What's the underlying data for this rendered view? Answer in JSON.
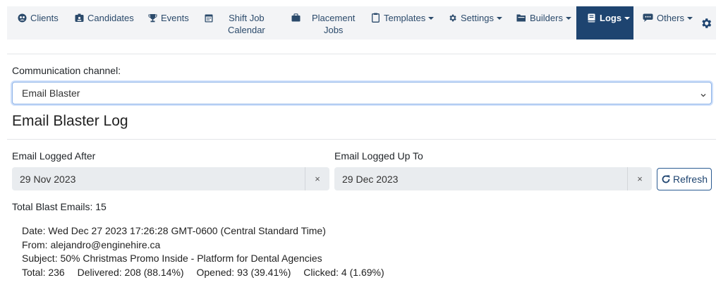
{
  "nav": {
    "clients": "Clients",
    "candidates": "Candidates",
    "events": "Events",
    "shift_line1": "Shift Job",
    "shift_line2": "Calendar",
    "placement_line1": "Placement",
    "placement_line2": "Jobs",
    "templates": "Templates",
    "settings": "Settings",
    "builders": "Builders",
    "logs": "Logs",
    "others": "Others"
  },
  "channel": {
    "label": "Communication channel:",
    "selected": "Email Blaster"
  },
  "section_title": "Email Blaster Log",
  "filters": {
    "after_label": "Email Logged After",
    "after_value": "29 Nov 2023",
    "upto_label": "Email Logged Up To",
    "upto_value": "29 Dec 2023",
    "clear_glyph": "×",
    "refresh_label": "Refresh"
  },
  "total_text": "Total Blast Emails: 15",
  "log_entry": {
    "date": "Date: Wed Dec 27 2023 17:26:28 GMT-0600 (Central Standard Time)",
    "from": "From: alejandro@enginehire.ca",
    "subject": "Subject: 50% Christmas Promo Inside - Platform for Dental Agencies",
    "total": "Total: 236",
    "delivered": "Delivered: 208 (88.14%)",
    "opened": "Opened: 93 (39.41%)",
    "clicked": "Clicked: 4 (1.69%)"
  },
  "colors": {
    "nav_text": "#2b4a6b",
    "nav_active_bg": "#1e4470",
    "nav_bg": "#f3f4f6",
    "input_bg": "#e9ecef",
    "focus_border": "#8fb4e8"
  }
}
